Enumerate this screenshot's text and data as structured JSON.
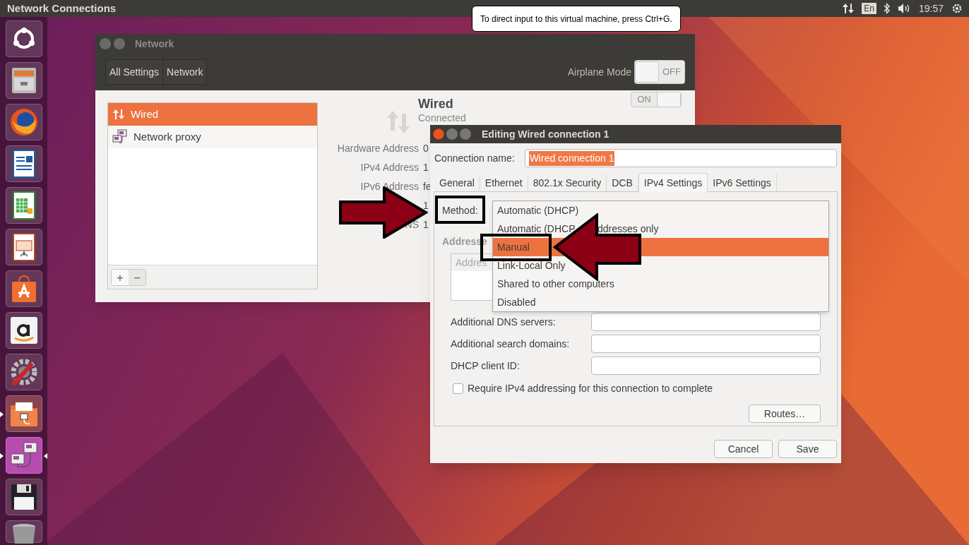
{
  "top_bar": {
    "title": "Network Connections",
    "tooltip": "To direct input to this virtual machine, press Ctrl+G.",
    "keyboard": "En",
    "clock": "19:57"
  },
  "launcher": {
    "items": [
      {
        "kind": "ubuntu",
        "running": false,
        "focused": false
      },
      {
        "kind": "files",
        "running": false,
        "focused": false
      },
      {
        "kind": "firefox",
        "running": false,
        "focused": false
      },
      {
        "kind": "writer",
        "running": false,
        "focused": false
      },
      {
        "kind": "calc",
        "running": false,
        "focused": false
      },
      {
        "kind": "impress",
        "running": false,
        "focused": false
      },
      {
        "kind": "store",
        "running": false,
        "focused": false
      },
      {
        "kind": "amazon",
        "running": false,
        "focused": false
      },
      {
        "kind": "settings",
        "running": false,
        "focused": false
      },
      {
        "kind": "share",
        "running": true,
        "focused": false
      },
      {
        "kind": "network",
        "running": true,
        "focused": true
      },
      {
        "kind": "floppy",
        "running": false,
        "focused": false
      },
      {
        "kind": "trash",
        "running": false,
        "focused": false
      }
    ]
  },
  "network_window": {
    "title": "Network",
    "header_buttons": [
      "All Settings",
      "Network"
    ],
    "airplane_mode": {
      "label": "Airplane Mode",
      "state": "OFF",
      "on": false
    },
    "devices": [
      {
        "kind": "wired",
        "label": "Wired",
        "selected": true
      },
      {
        "kind": "proxy",
        "label": "Network proxy",
        "selected": false
      }
    ],
    "list_buttons": [
      "+",
      "−"
    ],
    "device": {
      "name": "Wired",
      "status": "Connected",
      "switch": {
        "state": "ON",
        "on": true
      },
      "details": [
        {
          "label": "Hardware Address",
          "value": "0"
        },
        {
          "label": "IPv4 Address",
          "value": "1"
        },
        {
          "label": "IPv6 Address",
          "value": "fe"
        },
        {
          "value": "1"
        },
        {
          "label": "NS",
          "value": "1"
        }
      ]
    }
  },
  "editor": {
    "title": "Editing Wired connection 1",
    "connection_name": {
      "label": "Connection name:",
      "value": "Wired connection 1"
    },
    "tabs": [
      {
        "label": "General",
        "selected": false
      },
      {
        "label": "Ethernet",
        "selected": false
      },
      {
        "label": "802.1x Security",
        "selected": false
      },
      {
        "label": "DCB",
        "selected": false
      },
      {
        "label": "IPv4 Settings",
        "selected": true
      },
      {
        "label": "IPv6 Settings",
        "selected": false
      }
    ],
    "method": {
      "label": "Method:",
      "options": [
        {
          "label": "Automatic (DHCP)",
          "selected": false
        },
        {
          "label_parts": [
            "Automatic (DHCP",
            "ddresses only"
          ],
          "selected": false
        },
        {
          "label": "Manual",
          "selected": true
        },
        {
          "label": "Link-Local Only",
          "selected": false
        },
        {
          "label": "Shared to other computers",
          "selected": false
        },
        {
          "label": "Disabled",
          "selected": false
        }
      ]
    },
    "addresses": {
      "label": "Addresse",
      "column_1": "Addres"
    },
    "fields": [
      {
        "label": "Additional DNS servers:"
      },
      {
        "label": "Additional search domains:"
      },
      {
        "label": "DHCP client ID:"
      }
    ],
    "require_checkbox": {
      "label": "Require IPv4 addressing for this connection to complete",
      "checked": false
    },
    "routes_button": "Routes…",
    "buttons": [
      "Cancel",
      "Save"
    ]
  }
}
